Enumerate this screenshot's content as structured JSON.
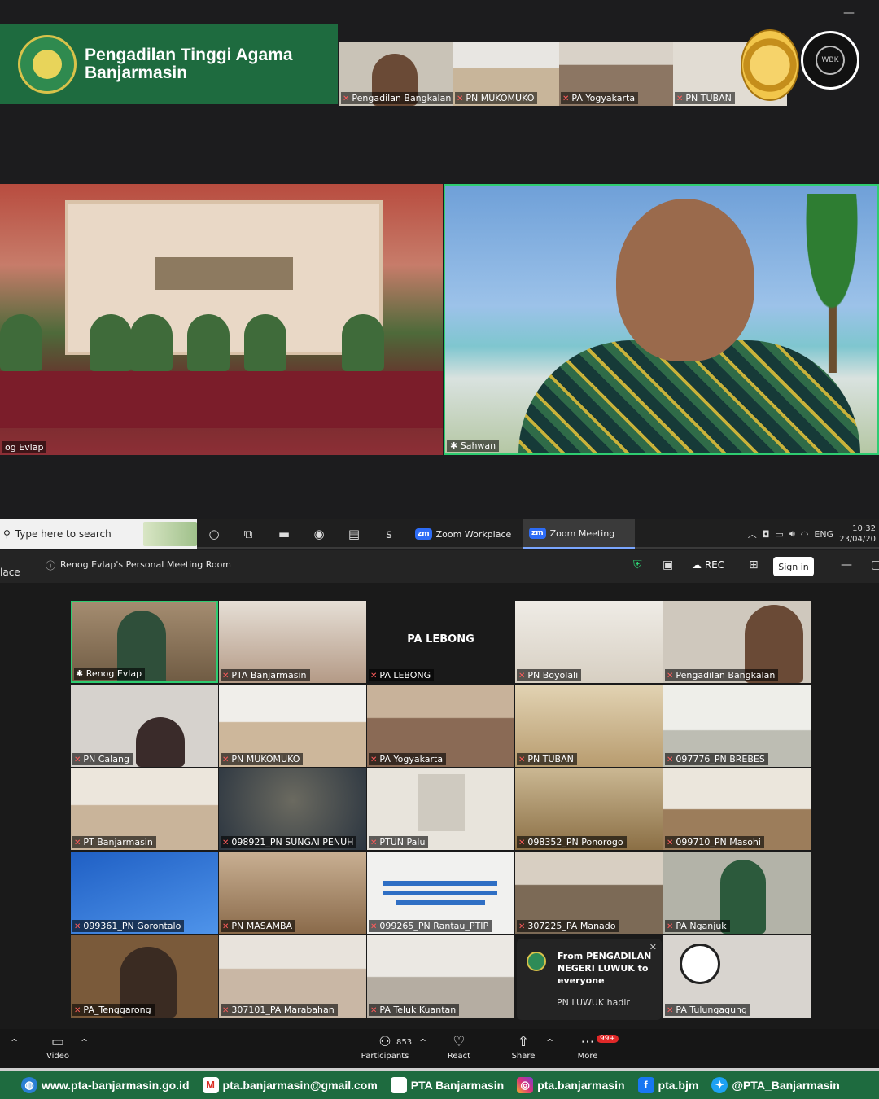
{
  "banner": {
    "title_line1": "Pengadilan Tinggi Agama",
    "title_line2": "Banjarmasin"
  },
  "top_strip": [
    {
      "label": "Pengadilan Bangkalan",
      "color": "#c9c3b7"
    },
    {
      "label": "PN MUKOMUKO",
      "color": "#c8b59a"
    },
    {
      "label": "PA Yogyakarta",
      "color": "#8c7663"
    },
    {
      "label": "PN TUBAN",
      "color": "#e1dcd3"
    }
  ],
  "main_videos": {
    "left_label": "og Evlap",
    "right_label": "Sahwan"
  },
  "taskbar": {
    "search_placeholder": "Type here to search",
    "app_workplace": "Zoom Workplace",
    "app_meeting": "Zoom Meeting",
    "lang": "ENG",
    "time": "10:32",
    "date": "23/04/20"
  },
  "zoom": {
    "left_cut": "lace",
    "room_title": "Renog Evlap's Personal Meeting Room",
    "rec": "REC",
    "sign_in": "Sign in",
    "tiles": [
      {
        "label": "Renog Evlap",
        "color": "#8d7a5a"
      },
      {
        "label": "PTA Banjarmasin",
        "color": "#b49a86"
      },
      {
        "label": "PA LEBONG",
        "color": "#1a1a1a",
        "center_text": "PA LEBONG"
      },
      {
        "label": "PN Boyolali",
        "color": "#d7cfc2"
      },
      {
        "label": "Pengadilan Bangkalan",
        "color": "#cfc8bd"
      },
      {
        "label": "PN Calang",
        "color": "#d6d2cd"
      },
      {
        "label": "PN MUKOMUKO",
        "color": "#cdb79b"
      },
      {
        "label": "PA Yogyakarta",
        "color": "#8a6a55"
      },
      {
        "label": "PN TUBAN",
        "color": "#d9c7a6"
      },
      {
        "label": "097776_PN BREBES",
        "color": "#d0d0c8"
      },
      {
        "label": "PT Banjarmasin",
        "color": "#c9b49a"
      },
      {
        "label": "098921_PN SUNGAI PENUH",
        "color": "#3b4650"
      },
      {
        "label": "PTUN Palu",
        "color": "#e8e4dc"
      },
      {
        "label": "098352_PN Ponorogo",
        "color": "#a08a5e"
      },
      {
        "label": "099710_PN Masohi",
        "color": "#cfc8bc"
      },
      {
        "label": "099361_PN Gorontalo",
        "color": "#2f6fd0"
      },
      {
        "label": "PN MASAMBA",
        "color": "#a88a6a"
      },
      {
        "label": "099265_PN Rantau_PTIP",
        "color": "#f1f1ef"
      },
      {
        "label": "307225_PA Manado",
        "color": "#8c7a66"
      },
      {
        "label": "PA Nganjuk",
        "color": "#b3b3a8"
      },
      {
        "label": "PA_Tenggarong",
        "color": "#7a5a3a"
      },
      {
        "label": "307101_PA Marabahan",
        "color": "#c9b7a5"
      },
      {
        "label": "PA Teluk Kuantan",
        "color": "#d5d0c7"
      },
      {
        "label": "",
        "color": "#1a1a1a"
      },
      {
        "label": "PA Tulungagung",
        "color": "#d8d4cf"
      }
    ],
    "chat": {
      "from": "From PENGADILAN NEGERI LUWUK to everyone",
      "message": "PN LUWUK hadir"
    },
    "controls": {
      "video": "Video",
      "participants": "Participants",
      "participant_count": "853",
      "react": "React",
      "share": "Share",
      "more": "More",
      "more_badge": "99+"
    }
  },
  "footer": {
    "website": "www.pta-banjarmasin.go.id",
    "email": "pta.banjarmasin@gmail.com",
    "youtube": "PTA Banjarmasin",
    "instagram": "pta.banjarmasin",
    "facebook": "pta.bjm",
    "twitter": "@PTA_Banjarmasin"
  }
}
